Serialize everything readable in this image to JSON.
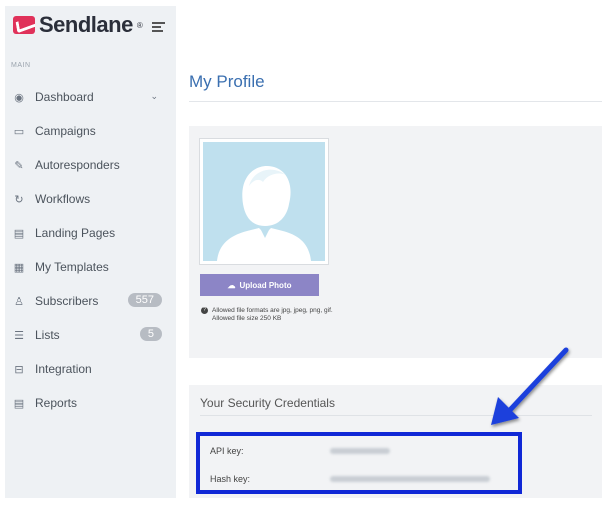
{
  "brand": {
    "name": "Sendlane",
    "trademark": "®"
  },
  "sidebar": {
    "section_label": "MAIN",
    "items": [
      {
        "label": "Dashboard",
        "icon": "dashboard-icon",
        "has_chevron": true
      },
      {
        "label": "Campaigns",
        "icon": "campaigns-icon"
      },
      {
        "label": "Autoresponders",
        "icon": "autoresponders-icon"
      },
      {
        "label": "Workflows",
        "icon": "workflows-icon"
      },
      {
        "label": "Landing Pages",
        "icon": "landing-pages-icon"
      },
      {
        "label": "My Templates",
        "icon": "templates-icon"
      },
      {
        "label": "Subscribers",
        "icon": "subscribers-icon",
        "badge": "557"
      },
      {
        "label": "Lists",
        "icon": "lists-icon",
        "badge": "5"
      },
      {
        "label": "Integration",
        "icon": "integration-icon"
      },
      {
        "label": "Reports",
        "icon": "reports-icon"
      }
    ]
  },
  "main": {
    "title": "My Profile",
    "profile": {
      "upload_label": "Upload Photo",
      "note_line1": "Allowed file formats are jpg, jpeg, png, gif.",
      "note_line2": "Allowed file size 250 KB"
    },
    "security": {
      "title": "Your Security Credentials",
      "api_key_label": "API key:",
      "hash_key_label": "Hash key:"
    }
  },
  "colors": {
    "accent": "#3a6fb0",
    "upload_button": "#8c85c6",
    "highlight": "#1028d6",
    "brand": "#e0325a"
  }
}
